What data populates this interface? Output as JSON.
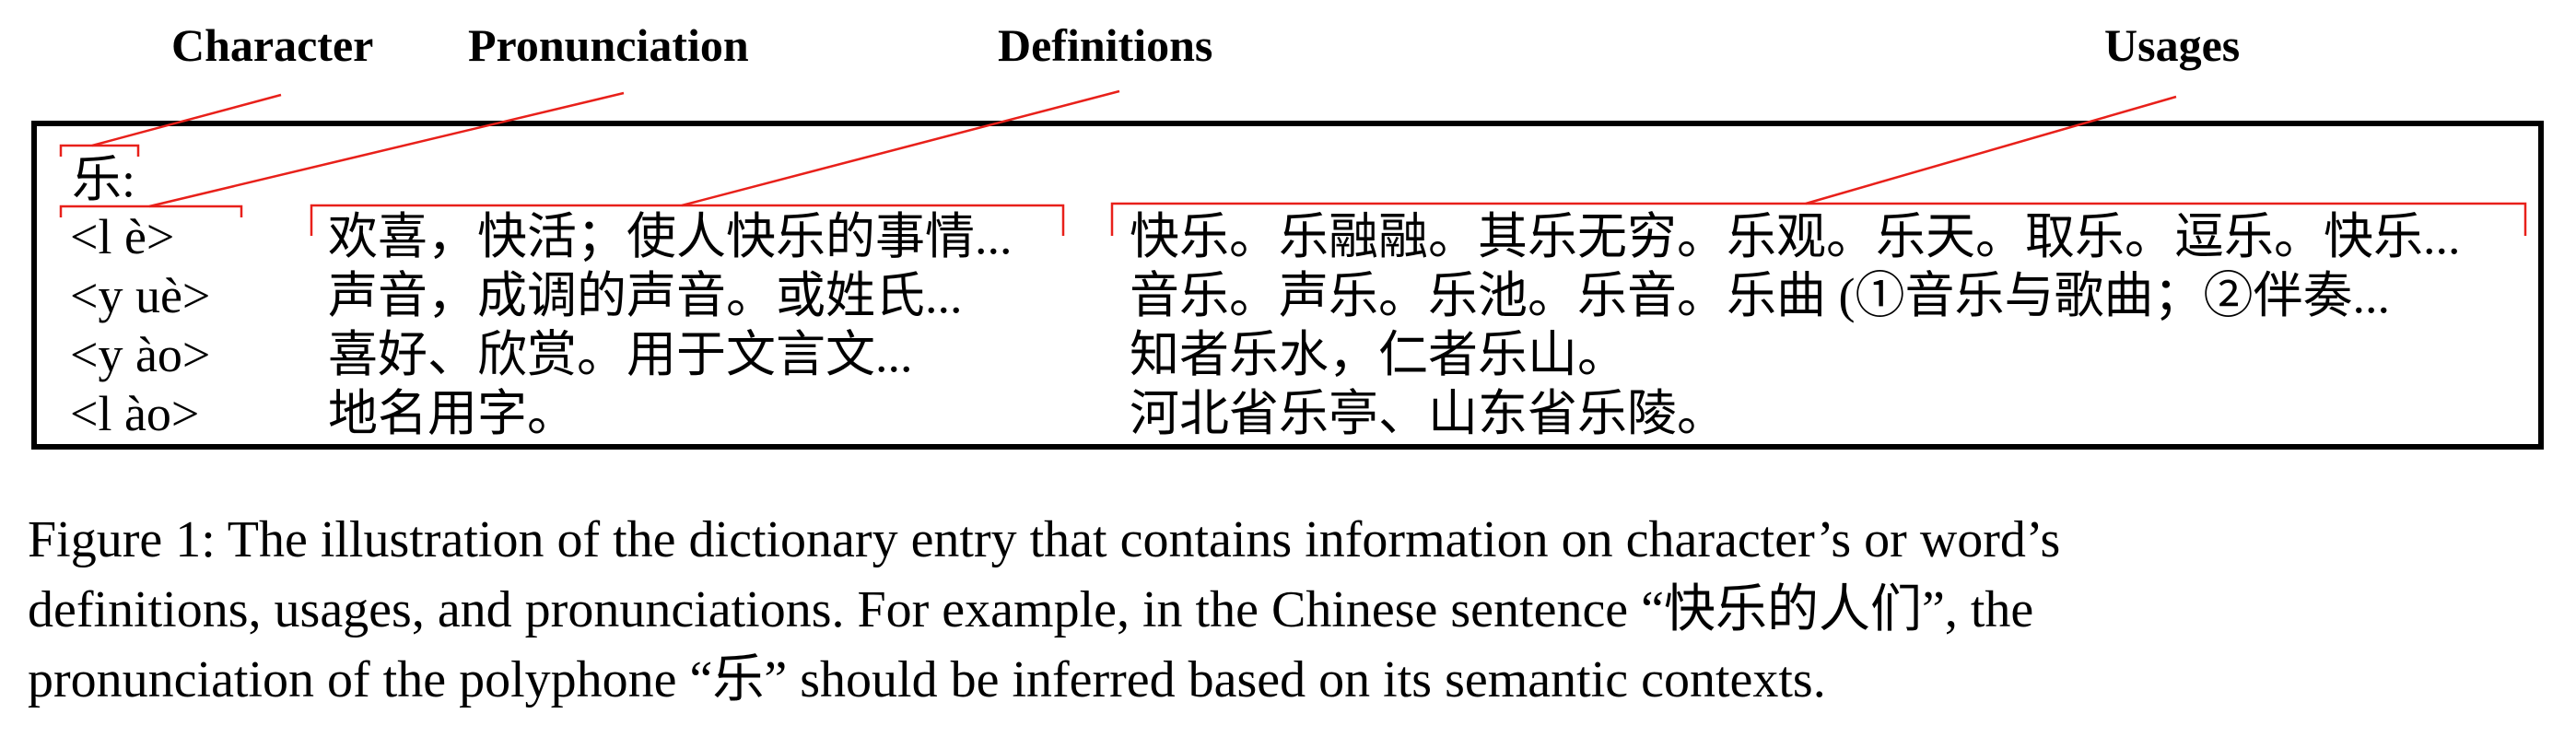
{
  "labels": {
    "character": "Character",
    "pronunciation": "Pronunciation",
    "definitions": "Definitions",
    "usages": "Usages"
  },
  "entry": {
    "character": "乐:",
    "rows": [
      {
        "pron": "<l  è>",
        "def": "欢喜，快活；使人快乐的事情...",
        "use": "快乐。乐融融。其乐无穷。乐观。乐天。取乐。逗乐。快乐..."
      },
      {
        "pron": "<y uè>",
        "def": "声音，成调的声音。或姓氏...",
        "use": "音乐。声乐。乐池。乐音。乐曲 (①音乐与歌曲；②伴奏..."
      },
      {
        "pron": "<y ào>",
        "def": "喜好、欣赏。用于文言文...",
        "use": "知者乐水，仁者乐山。"
      },
      {
        "pron": "<l  ào>",
        "def": "地名用字。",
        "use": "河北省乐亭、山东省乐陵。"
      }
    ]
  },
  "caption": {
    "line1": "Figure 1: The illustration of the dictionary entry that contains information on character’s or word’s",
    "line2_a": "definitions, usages, and pronunciations. For example, in the Chinese sentence “",
    "line2_cjk": "快乐的人们",
    "line2_b": "”, the",
    "line3_a": "pronunciation of the polyphone “",
    "line3_cjk": "乐",
    "line3_b": "” should be inferred based on its semantic contexts."
  },
  "colors": {
    "annotation": "#e8201a",
    "text": "#000000"
  }
}
